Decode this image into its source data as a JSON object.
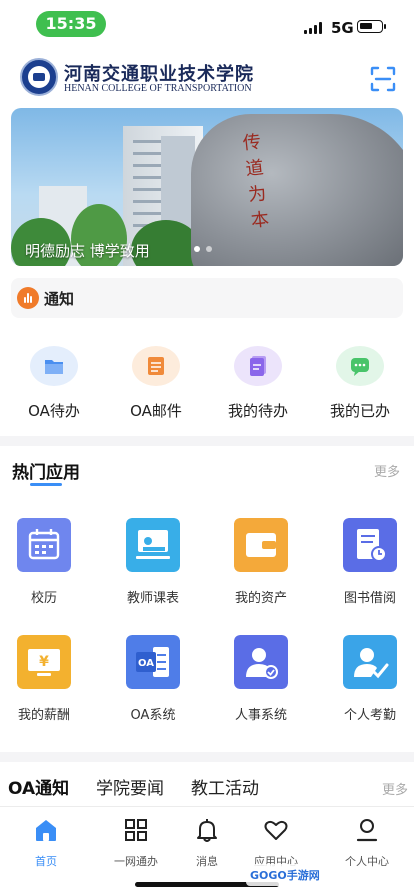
{
  "status_bar": {
    "time": "15:35",
    "network": "5G",
    "battery_level": 0.6
  },
  "header": {
    "school_name_cn": "河南交通职业技术学院",
    "school_name_en": "HENAN COLLEGE OF TRANSPORTATION",
    "scan_icon": "scan-icon"
  },
  "banner": {
    "caption": "明德励志 博学致用",
    "slide_count": 2,
    "active_slide": 1
  },
  "notice": {
    "label": "通知",
    "icon": "sound-wave-icon",
    "icon_color": "#f07b2a"
  },
  "quick_actions": [
    {
      "label": "OA待办",
      "icon": "folder-icon",
      "color": "#4a8ff0"
    },
    {
      "label": "OA邮件",
      "icon": "mail-icon",
      "color": "#f08a3a"
    },
    {
      "label": "我的待办",
      "icon": "document-icon",
      "color": "#8a66ea"
    },
    {
      "label": "我的已办",
      "icon": "chat-icon",
      "color": "#48c46a"
    }
  ],
  "hot_apps": {
    "title": "热门应用",
    "more_label": "更多",
    "accent_color": "#3a8ef6",
    "items": [
      {
        "label": "校历",
        "icon": "calendar-icon",
        "color": "#6f86ee"
      },
      {
        "label": "教师课表",
        "icon": "presentation-icon",
        "color": "#38aee8"
      },
      {
        "label": "我的资产",
        "icon": "wallet-icon",
        "color": "#f4a93a"
      },
      {
        "label": "图书借阅",
        "icon": "book-icon",
        "color": "#5a6de6"
      },
      {
        "label": "我的薪酬",
        "icon": "salary-icon",
        "color": "#f3b12f"
      },
      {
        "label": "OA系统",
        "icon": "office-icon",
        "color": "#4f7de8"
      },
      {
        "label": "人事系统",
        "icon": "person-check-icon",
        "color": "#5a6de6"
      },
      {
        "label": "个人考勤",
        "icon": "attendance-icon",
        "color": "#3aa4e8"
      }
    ]
  },
  "news_tabs": {
    "tabs": [
      "OA通知",
      "学院要闻",
      "教工活动"
    ],
    "active_index": 0,
    "more_label": "更多"
  },
  "bottom_nav": [
    {
      "label": "首页",
      "icon": "home-icon",
      "active": true
    },
    {
      "label": "一网通办",
      "icon": "grid-icon",
      "active": false
    },
    {
      "label": "消息",
      "icon": "bell-icon",
      "active": false
    },
    {
      "label": "应用中心",
      "icon": "heart-icon",
      "active": false
    },
    {
      "label": "个人中心",
      "icon": "person-icon",
      "active": false
    }
  ],
  "watermark": "GOGO手游网"
}
